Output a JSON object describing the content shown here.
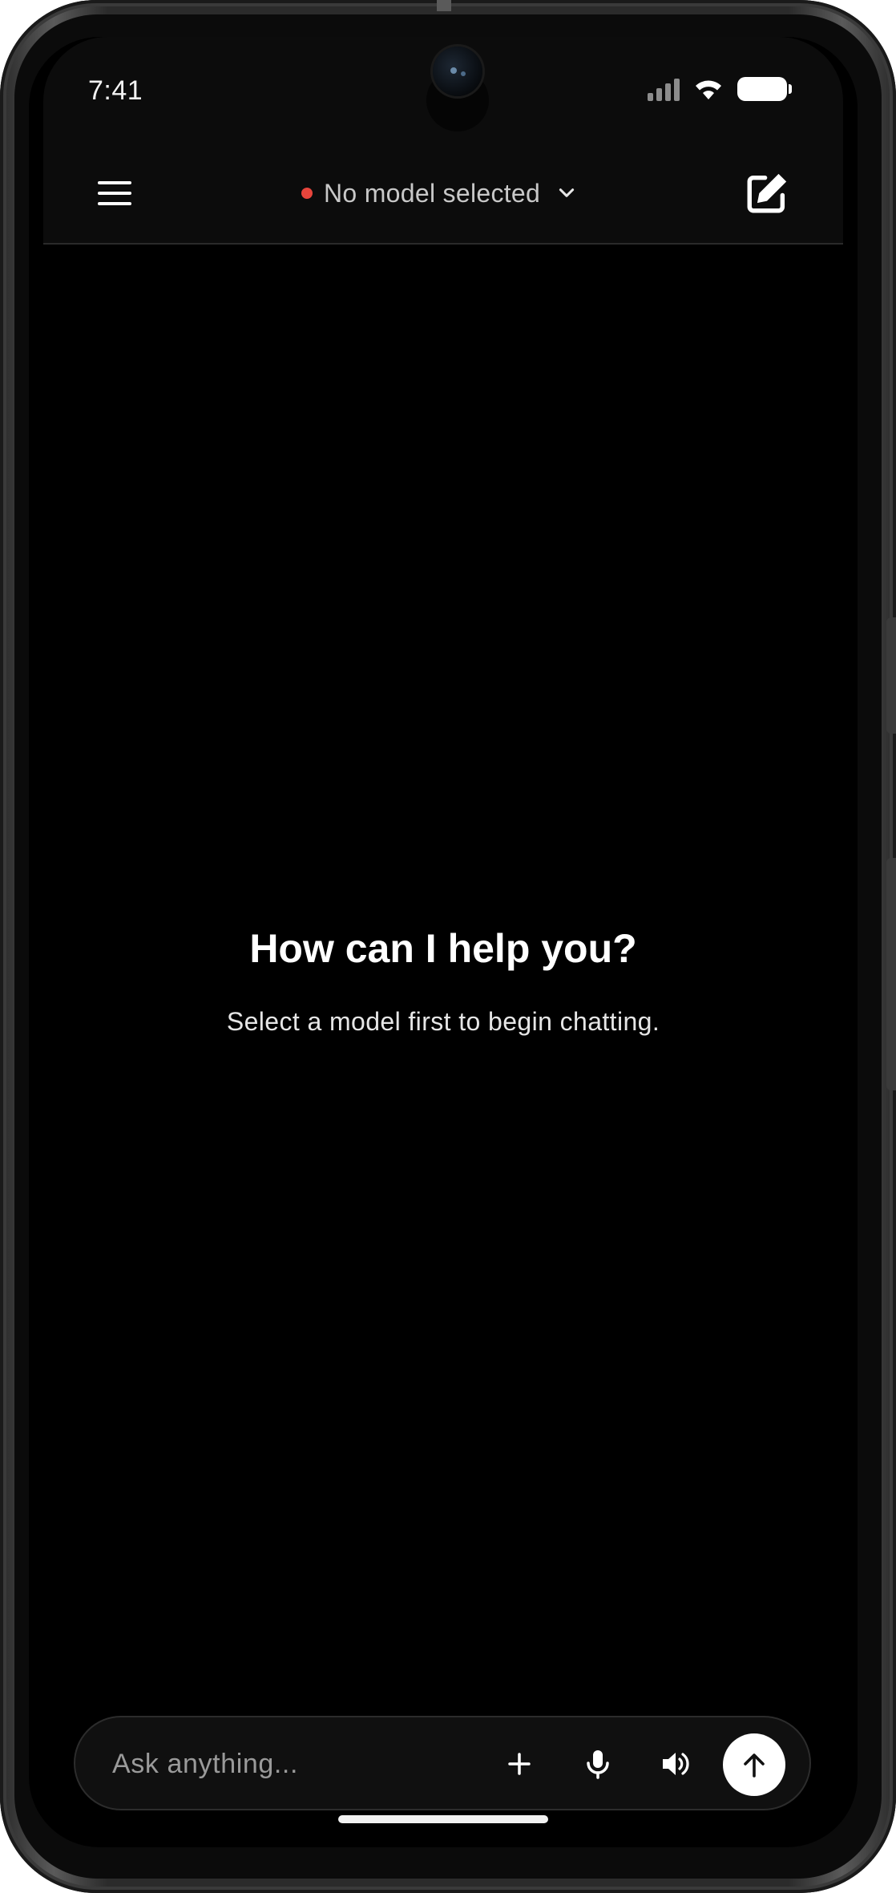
{
  "status_bar": {
    "time": "7:41"
  },
  "header": {
    "model_status_color": "#e8453c",
    "model_label": "No model selected"
  },
  "empty_state": {
    "title": "How can I help you?",
    "subtitle": "Select a model first to begin chatting."
  },
  "composer": {
    "placeholder": "Ask anything...",
    "value": ""
  },
  "icons": {
    "menu": "menu-icon",
    "chevron": "chevron-down-icon",
    "new_chat": "edit-icon",
    "add": "plus-icon",
    "mic": "microphone-icon",
    "speaker": "speaker-icon",
    "send": "arrow-up-icon"
  }
}
